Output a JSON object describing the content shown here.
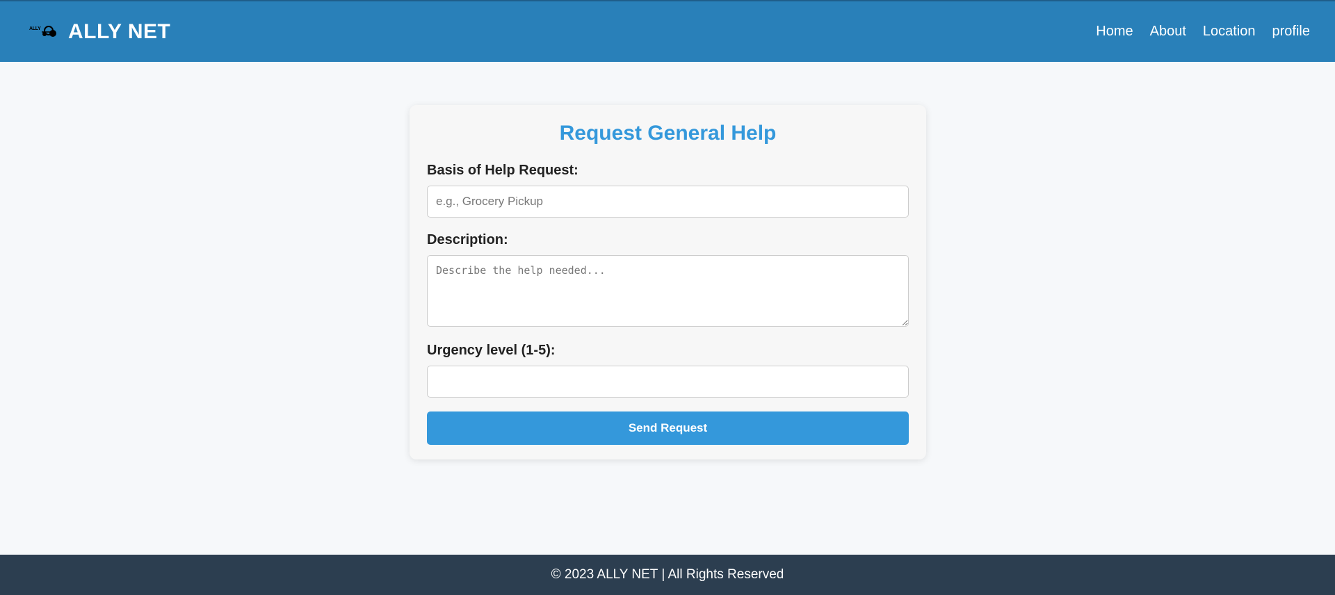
{
  "header": {
    "logo_text": "ALLY",
    "brand": "ALLY NET",
    "nav": [
      {
        "label": "Home"
      },
      {
        "label": "About"
      },
      {
        "label": "Location"
      },
      {
        "label": "profile"
      }
    ]
  },
  "form": {
    "title": "Request General Help",
    "basis": {
      "label": "Basis of Help Request:",
      "value": "",
      "placeholder": "e.g., Grocery Pickup"
    },
    "description": {
      "label": "Description:",
      "value": "",
      "placeholder": "Describe the help needed..."
    },
    "urgency": {
      "label": "Urgency level (1-5):",
      "value": "",
      "placeholder": ""
    },
    "submit_label": "Send Request"
  },
  "footer": {
    "text": "© 2023 ALLY NET | All Rights Reserved"
  },
  "colors": {
    "header_bg": "#2980b9",
    "accent": "#3498db",
    "footer_bg": "#2c3e50",
    "page_bg": "#f6f8fa"
  },
  "icons": {
    "logo": "ally-net-logo-icon"
  }
}
